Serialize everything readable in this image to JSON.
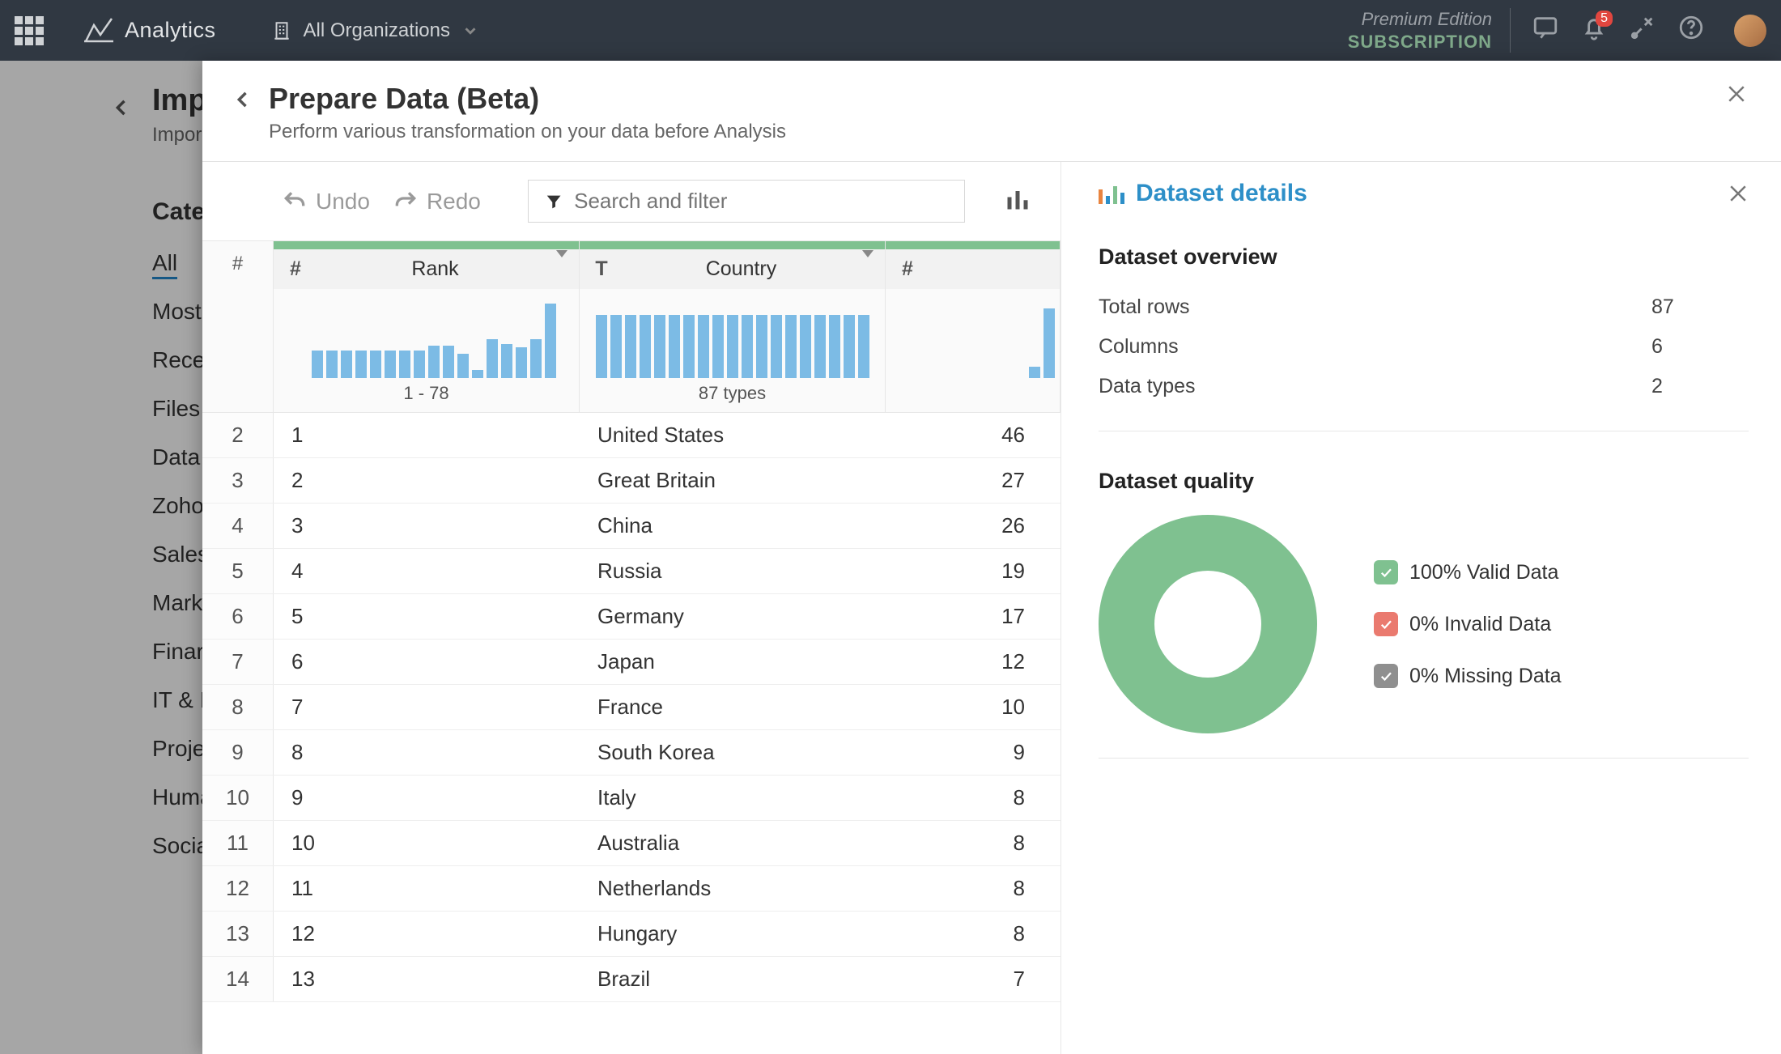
{
  "topnav": {
    "brand": "Analytics",
    "org_label": "All Organizations",
    "edition_line1": "Premium Edition",
    "edition_line2": "SUBSCRIPTION",
    "notif_count": "5"
  },
  "under_page": {
    "title_partial": "Imp",
    "subtitle_partial": "Impor",
    "categories_heading": "Cate",
    "categories": [
      "All",
      "Most",
      "Rece",
      "Files",
      "Data",
      "Zoho",
      "Sales",
      "Mark",
      "Finar",
      "IT & I",
      "Proje",
      "Huma",
      "Socia"
    ],
    "active_index": 0
  },
  "panel": {
    "title": "Prepare Data (Beta)",
    "subtitle": "Perform various transformation on your data before Analysis",
    "undo": "Undo",
    "redo": "Redo",
    "search_placeholder": "Search and filter"
  },
  "columns": {
    "rownum_symbol": "#",
    "rank": {
      "type": "#",
      "label": "Rank",
      "histo_sub": "1 - 78",
      "bars": [
        0,
        34,
        34,
        34,
        34,
        34,
        34,
        34,
        34,
        40,
        40,
        30,
        10,
        48,
        42,
        38,
        48,
        92
      ]
    },
    "country": {
      "type": "T",
      "label": "Country",
      "histo_sub": "87 types",
      "bars": [
        78,
        78,
        78,
        78,
        78,
        78,
        78,
        78,
        78,
        78,
        78,
        78,
        78,
        78,
        78,
        78,
        78,
        78,
        78
      ]
    },
    "gold": {
      "type": "#",
      "label": "",
      "histo_sub": "",
      "bars": [
        14,
        86
      ]
    }
  },
  "rows": [
    {
      "n": "2",
      "rank": "1",
      "country": "United States",
      "gold": "46"
    },
    {
      "n": "3",
      "rank": "2",
      "country": "Great Britain",
      "gold": "27"
    },
    {
      "n": "4",
      "rank": "3",
      "country": "China",
      "gold": "26"
    },
    {
      "n": "5",
      "rank": "4",
      "country": "Russia",
      "gold": "19"
    },
    {
      "n": "6",
      "rank": "5",
      "country": "Germany",
      "gold": "17"
    },
    {
      "n": "7",
      "rank": "6",
      "country": "Japan",
      "gold": "12"
    },
    {
      "n": "8",
      "rank": "7",
      "country": "France",
      "gold": "10"
    },
    {
      "n": "9",
      "rank": "8",
      "country": "South Korea",
      "gold": "9"
    },
    {
      "n": "10",
      "rank": "9",
      "country": "Italy",
      "gold": "8"
    },
    {
      "n": "11",
      "rank": "10",
      "country": "Australia",
      "gold": "8"
    },
    {
      "n": "12",
      "rank": "11",
      "country": "Netherlands",
      "gold": "8"
    },
    {
      "n": "13",
      "rank": "12",
      "country": "Hungary",
      "gold": "8"
    },
    {
      "n": "14",
      "rank": "13",
      "country": "Brazil",
      "gold": "7"
    }
  ],
  "details": {
    "title": "Dataset details",
    "overview_heading": "Dataset overview",
    "overview": [
      {
        "k": "Total rows",
        "v": "87"
      },
      {
        "k": "Columns",
        "v": "6"
      },
      {
        "k": "Data types",
        "v": "2"
      }
    ],
    "quality_heading": "Dataset quality",
    "legend": [
      {
        "color": "#7fc190",
        "label": "100% Valid Data"
      },
      {
        "color": "#ea7a6f",
        "label": "0% Invalid Data"
      },
      {
        "color": "#8f8f8f",
        "label": "0% Missing Data"
      }
    ]
  },
  "chart_data": {
    "type": "pie",
    "title": "Dataset quality",
    "series": [
      {
        "name": "Valid Data",
        "value": 100
      },
      {
        "name": "Invalid Data",
        "value": 0
      },
      {
        "name": "Missing Data",
        "value": 0
      }
    ]
  }
}
